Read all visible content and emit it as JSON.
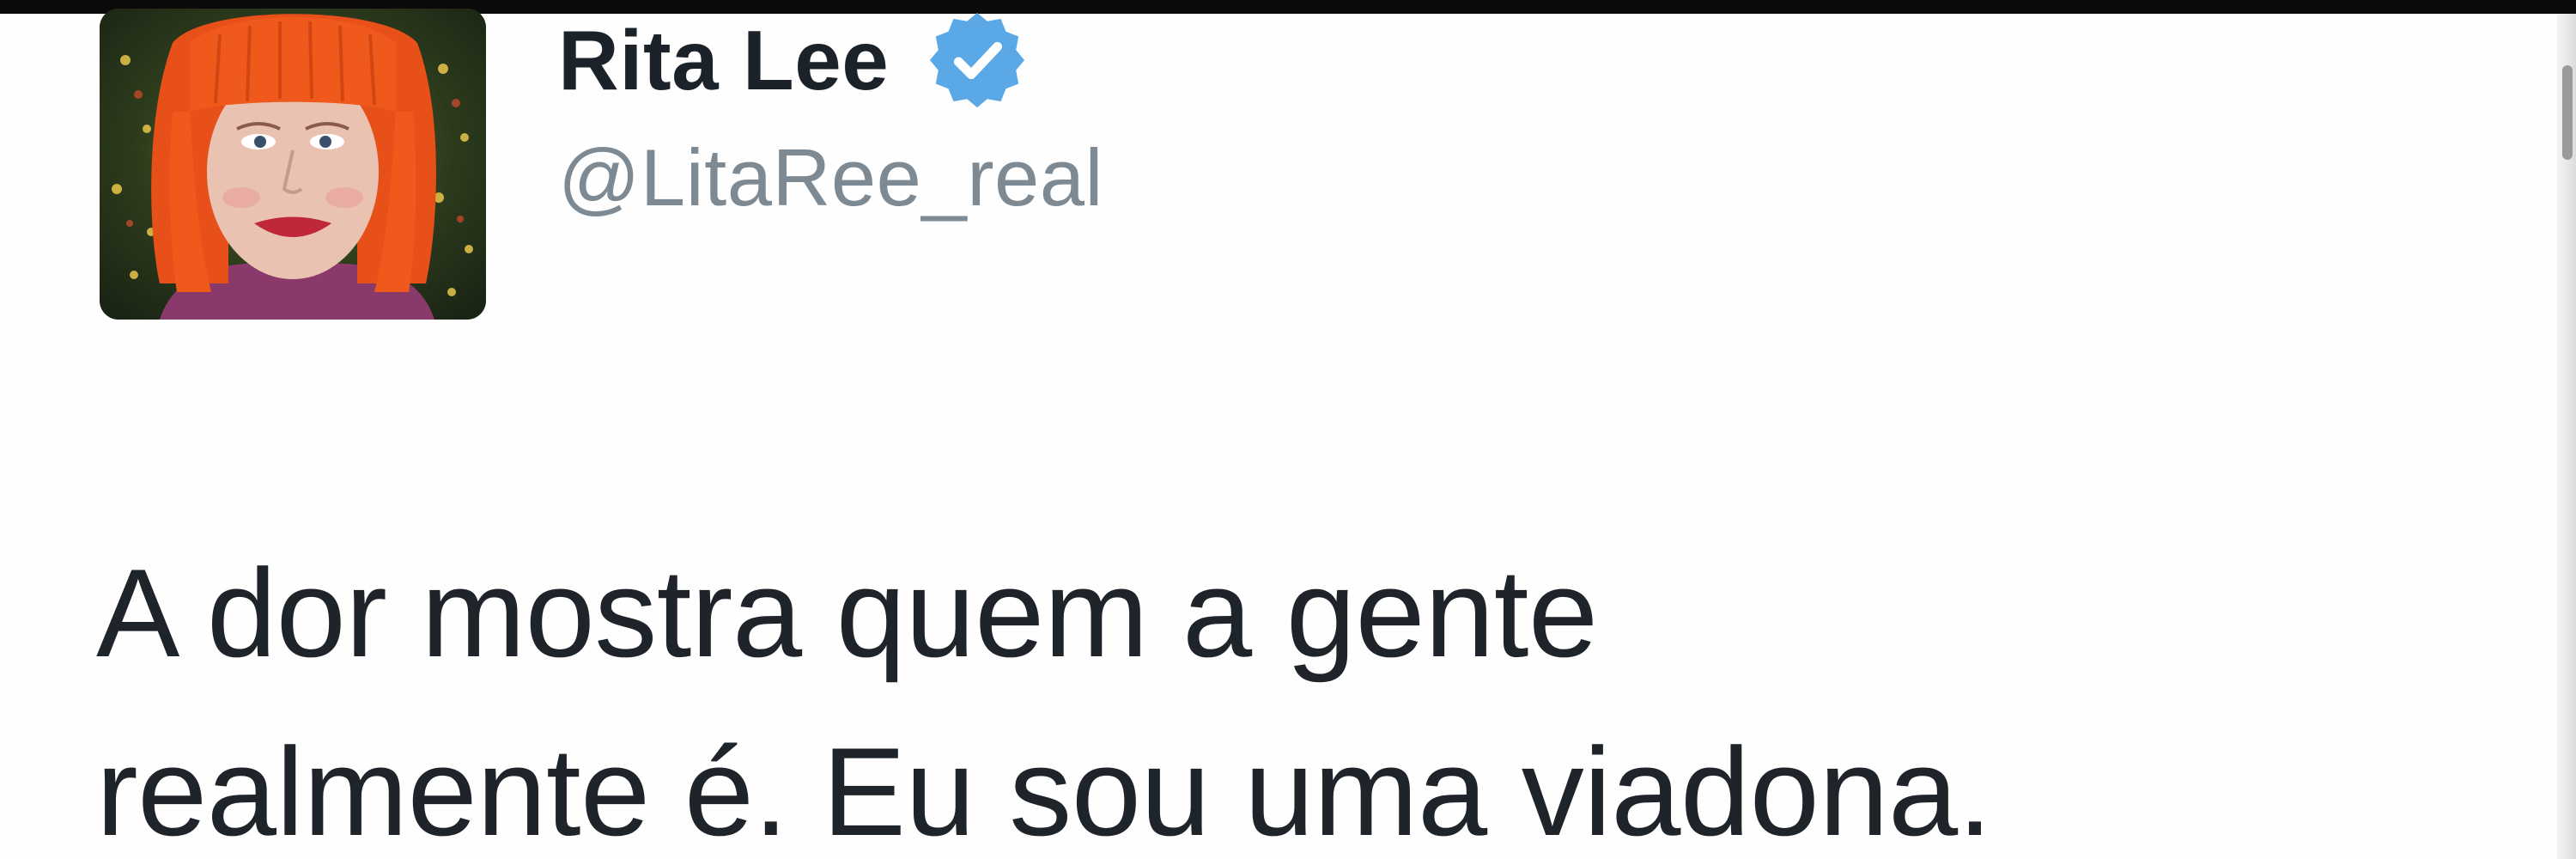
{
  "tweet": {
    "author": {
      "display_name": "Rita Lee",
      "handle": "@LitaRee_real",
      "verified": true,
      "verified_icon": "verified-badge-icon",
      "avatar": "profile-avatar"
    },
    "text_lines": [
      "A dor mostra quem a gente",
      "realmente é. Eu sou uma viadona."
    ]
  },
  "colors": {
    "name": "#1c2229",
    "handle": "#7d8993",
    "verified": "#5aa9e6",
    "text": "#1f242a"
  }
}
